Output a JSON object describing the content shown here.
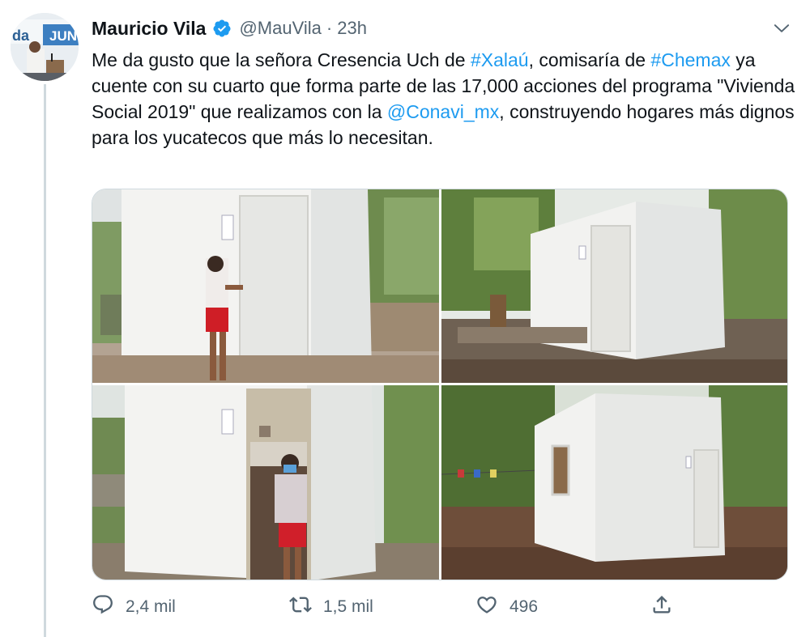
{
  "tweet": {
    "author_name": "Mauricio Vila",
    "handle": "@MauVila",
    "separator": "·",
    "time": "23h",
    "text": {
      "t1": "Me da gusto que la señora Cresencia Uch de ",
      "hashtag1": "#Xalaú",
      "t2": ", comisaría de ",
      "hashtag2": "#Chemax",
      "t3": " ya cuente con su cuarto que forma parte de las 17,000 acciones del programa \"Vivienda Social 2019\" que realizamos con la ",
      "mention": "@Conavi_mx",
      "t4": ", construyendo hogares más dignos para los yucatecos que más lo necesitan."
    },
    "avatar_banner_text": "JUN",
    "avatar_banner_text_small": "da"
  },
  "actions": {
    "reply_count": "2,4 mil",
    "retweet_count": "1,5 mil",
    "like_count": "496"
  },
  "icons": {
    "verified": "verified-badge-icon",
    "caret": "chevron-down-icon",
    "reply": "reply-icon",
    "retweet": "retweet-icon",
    "like": "heart-icon",
    "share": "share-icon"
  },
  "colors": {
    "link": "#1d9bf0",
    "secondary_text": "#536471",
    "primary_text": "#0f1419",
    "border": "#cfd9de"
  }
}
